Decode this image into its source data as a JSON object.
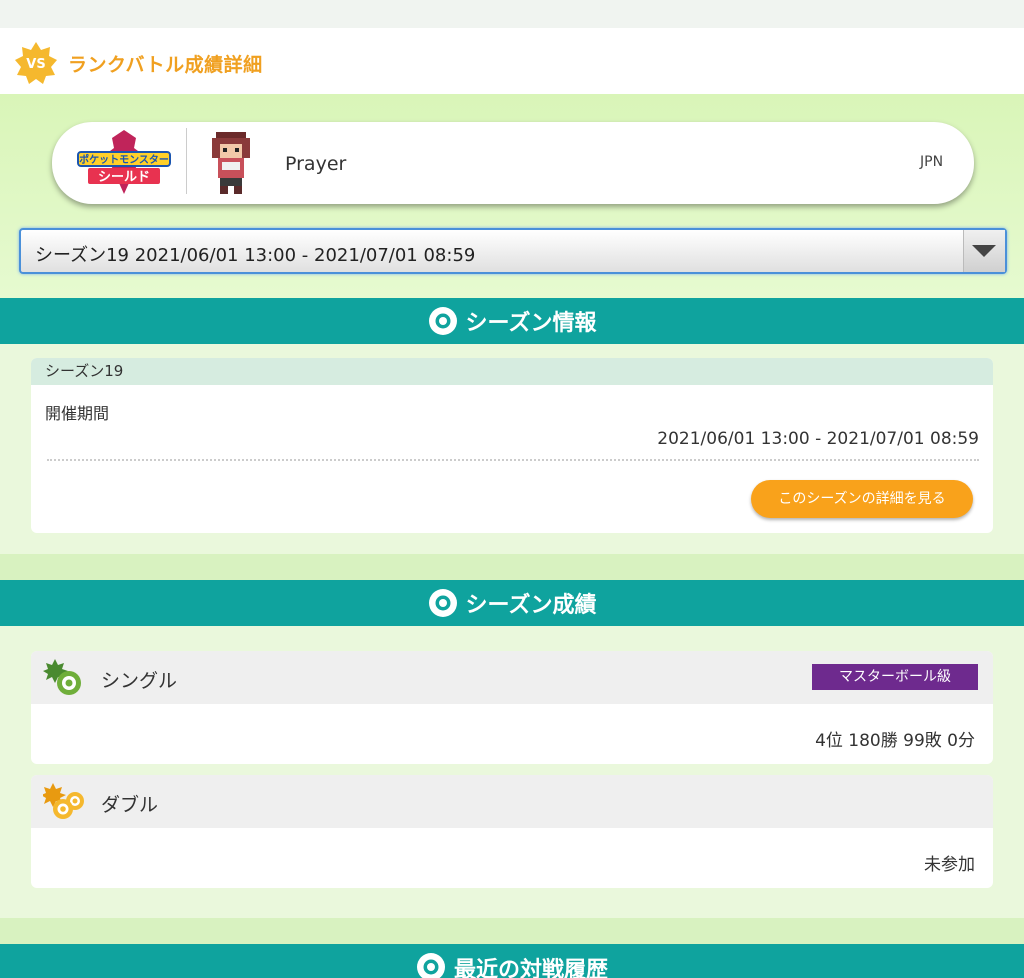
{
  "header": {
    "title": "ランクバトル成績詳細",
    "badge": "VS"
  },
  "profile": {
    "player_name": "Prayer",
    "region": "JPN",
    "game_logo_text": [
      "ポケットモンスター",
      "シールド"
    ]
  },
  "season_select": {
    "selected": "シーズン19 2021/06/01 13:00 - 2021/07/01 08:59"
  },
  "season_info": {
    "section_title": "シーズン情報",
    "card_title": "シーズン19",
    "period_label": "開催期間",
    "period_value": "2021/06/01 13:00 - 2021/07/01 08:59",
    "detail_button": "このシーズンの詳細を見る"
  },
  "season_results": {
    "section_title": "シーズン成績",
    "single": {
      "title": "シングル",
      "rank_class": "マスターボール級",
      "record": "4位 180勝 99敗 0分"
    },
    "double": {
      "title": "ダブル",
      "record": "未参加"
    }
  },
  "history": {
    "section_title": "最近の対戦履歴"
  },
  "colors": {
    "accent": "#f0a020",
    "section_bar": "#0fa39e",
    "button": "#f9a21b",
    "rank_badge": "#6e2a8e"
  }
}
